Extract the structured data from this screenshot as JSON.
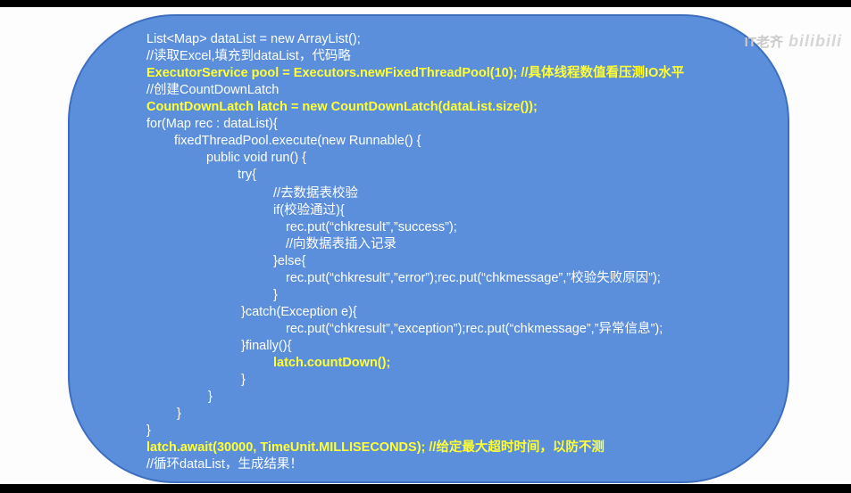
{
  "watermark": {
    "author": "IT老齐",
    "platform": "bilibili"
  },
  "colors": {
    "card_fill": "#5b8fdc",
    "text": "#ffffff",
    "highlight": "#ffff33"
  },
  "code_lines": [
    "List<Map> dataList = new ArrayList();",
    "//读取Excel,填充到dataList，代码略",
    "ExecutorService pool = Executors.newFixedThreadPool(10); //具体线程数值看压测IO水平",
    "//创建CountDownLatch",
    "CountDownLatch latch = new CountDownLatch(dataList.size());",
    "for(Map rec : dataList){",
    "fixedThreadPool.execute(new Runnable() {",
    "public void run() {",
    "try{",
    "//去数据表校验",
    "if(校验通过){",
    "rec.put(“chkresult”,”success”);",
    "//向数据表插入记录",
    "}else{",
    "rec.put(“chkresult”,”error”);rec.put(“chkmessage”,”校验失败原因”);",
    "}",
    "}catch(Exception e){",
    "rec.put(“chkresult”,”exception”);rec.put(“chkmessage”,”异常信息”);",
    "}finally(){",
    "latch.countDown();",
    "}",
    "}",
    "}",
    "}",
    "latch.await(30000, TimeUnit.MILLISECONDS); //给定最大超时时间，以防不测",
    "//循环dataList，生成结果！"
  ]
}
